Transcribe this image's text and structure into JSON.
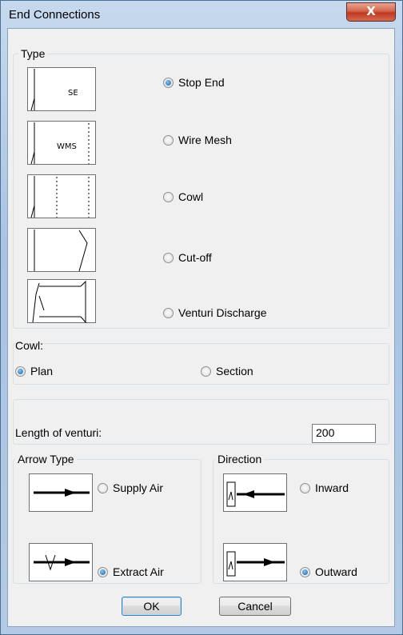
{
  "window": {
    "title": "End Connections",
    "close_glyph": "X"
  },
  "type_group": {
    "title": "Type",
    "options": [
      {
        "label": "Stop End",
        "checked": true,
        "thumb_text": "SE"
      },
      {
        "label": "Wire Mesh",
        "checked": false,
        "thumb_text": "WMS"
      },
      {
        "label": "Cowl",
        "checked": false,
        "thumb_text": ""
      },
      {
        "label": "Cut-off",
        "checked": false,
        "thumb_text": ""
      },
      {
        "label": "Venturi Discharge",
        "checked": false,
        "thumb_text": ""
      }
    ]
  },
  "cowl_group": {
    "title": "Cowl:",
    "options": [
      {
        "label": "Plan",
        "checked": true
      },
      {
        "label": "Section",
        "checked": false
      }
    ]
  },
  "venturi": {
    "label": "Length of venturi:",
    "value": "200"
  },
  "arrow_group": {
    "title": "Arrow Type",
    "options": [
      {
        "label": "Supply Air",
        "checked": false
      },
      {
        "label": "Extract Air",
        "checked": true
      }
    ]
  },
  "direction_group": {
    "title": "Direction",
    "options": [
      {
        "label": "Inward",
        "checked": false
      },
      {
        "label": "Outward",
        "checked": true
      }
    ]
  },
  "buttons": {
    "ok": "OK",
    "cancel": "Cancel"
  }
}
